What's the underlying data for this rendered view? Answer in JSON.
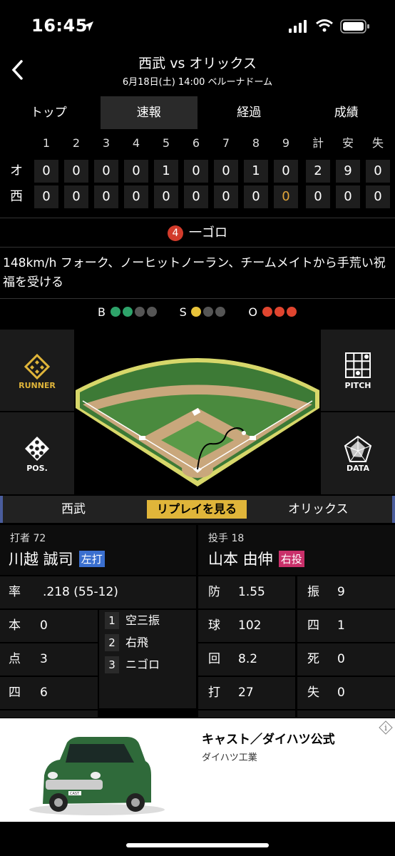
{
  "status_bar": {
    "time": "16:45"
  },
  "header": {
    "title": "西武 vs オリックス",
    "subtitle": "6月18日(土) 14:00 ベルーナドーム"
  },
  "tabs": [
    {
      "label": "トップ"
    },
    {
      "label": "速報",
      "active": true
    },
    {
      "label": "経過"
    },
    {
      "label": "成績"
    }
  ],
  "scoreboard": {
    "headers": [
      "1",
      "2",
      "3",
      "4",
      "5",
      "6",
      "7",
      "8",
      "9",
      "計",
      "安",
      "失"
    ],
    "teams": [
      {
        "abbr": "オ",
        "cells": [
          "0",
          "0",
          "0",
          "0",
          "1",
          "0",
          "0",
          "1",
          "0",
          "2",
          "9",
          "0"
        ]
      },
      {
        "abbr": "西",
        "cells": [
          "0",
          "0",
          "0",
          "0",
          "0",
          "0",
          "0",
          "0",
          "0",
          "0",
          "0",
          "0"
        ]
      }
    ]
  },
  "play": {
    "number": "4",
    "result": "一ゴロ"
  },
  "description": "148km/h フォーク、ノーヒットノーラン、チームメイトから手荒い祝福を受ける",
  "count": {
    "b_label": "B",
    "s_label": "S",
    "o_label": "O",
    "balls": 2,
    "strikes": 1,
    "outs": 3,
    "colors": {
      "ball": "#2ea36a",
      "strike": "#e8c33a",
      "out": "#e0452f",
      "off": "#555555"
    }
  },
  "side_buttons": {
    "runner": "RUNNER",
    "pitch": "PITCH",
    "pos": "POS.",
    "data": "DATA"
  },
  "team_bar": {
    "left": "西武",
    "replay": "リプレイを見る",
    "right": "オリックス"
  },
  "batter": {
    "role": "打者 72",
    "name": "川越 誠司",
    "hand": "左打",
    "stats": [
      {
        "label": "率",
        "value": ".218 (55-12)"
      },
      {
        "label": "本",
        "value": "0"
      },
      {
        "label": "点",
        "value": "3"
      },
      {
        "label": "四",
        "value": "6"
      }
    ],
    "at_bats": [
      {
        "n": "1",
        "result": "空三振"
      },
      {
        "n": "2",
        "result": "右飛"
      },
      {
        "n": "3",
        "result": "ニゴロ"
      }
    ]
  },
  "pitcher": {
    "role": "投手 18",
    "name": "山本 由伸",
    "hand": "右投",
    "stats_left": [
      {
        "label": "防",
        "value": "1.55"
      },
      {
        "label": "球",
        "value": "102"
      },
      {
        "label": "回",
        "value": "8.2"
      },
      {
        "label": "打",
        "value": "27"
      }
    ],
    "stats_right": [
      {
        "label": "振",
        "value": "9"
      },
      {
        "label": "四",
        "value": "1"
      },
      {
        "label": "死",
        "value": "0"
      },
      {
        "label": "失",
        "value": "0"
      }
    ]
  },
  "ad": {
    "title": "キャスト／ダイハツ公式",
    "sponsor": "ダイハツ工業",
    "car_badge": "CAST"
  }
}
